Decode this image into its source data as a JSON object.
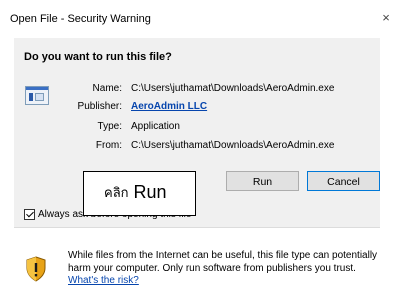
{
  "window": {
    "title": "Open File - Security Warning",
    "close_glyph": "×"
  },
  "question": "Do you want to run this file?",
  "details": {
    "name_label": "Name:",
    "name_value": "C:\\Users\\juthamat\\Downloads\\AeroAdmin.exe",
    "publisher_label": "Publisher:",
    "publisher_value": "AeroAdmin LLC",
    "type_label": "Type:",
    "type_value": "Application",
    "from_label": "From:",
    "from_value": "C:\\Users\\juthamat\\Downloads\\AeroAdmin.exe"
  },
  "buttons": {
    "run": "Run",
    "cancel": "Cancel"
  },
  "checkbox": {
    "label": "Always ask before opening this file",
    "checked": true
  },
  "annotation": {
    "prefix": "คลิก",
    "word": "Run"
  },
  "warning": {
    "text": "While files from the Internet can be useful, this file type can potentially harm your computer. Only run software from publishers you trust.",
    "link": "What's the risk?"
  },
  "colors": {
    "panel": "#f0f0f0",
    "link": "#0645ad",
    "focus_border": "#0078d7"
  },
  "icons": {
    "file": "application-window-icon",
    "warning": "shield-warning-icon",
    "close": "close-icon"
  }
}
